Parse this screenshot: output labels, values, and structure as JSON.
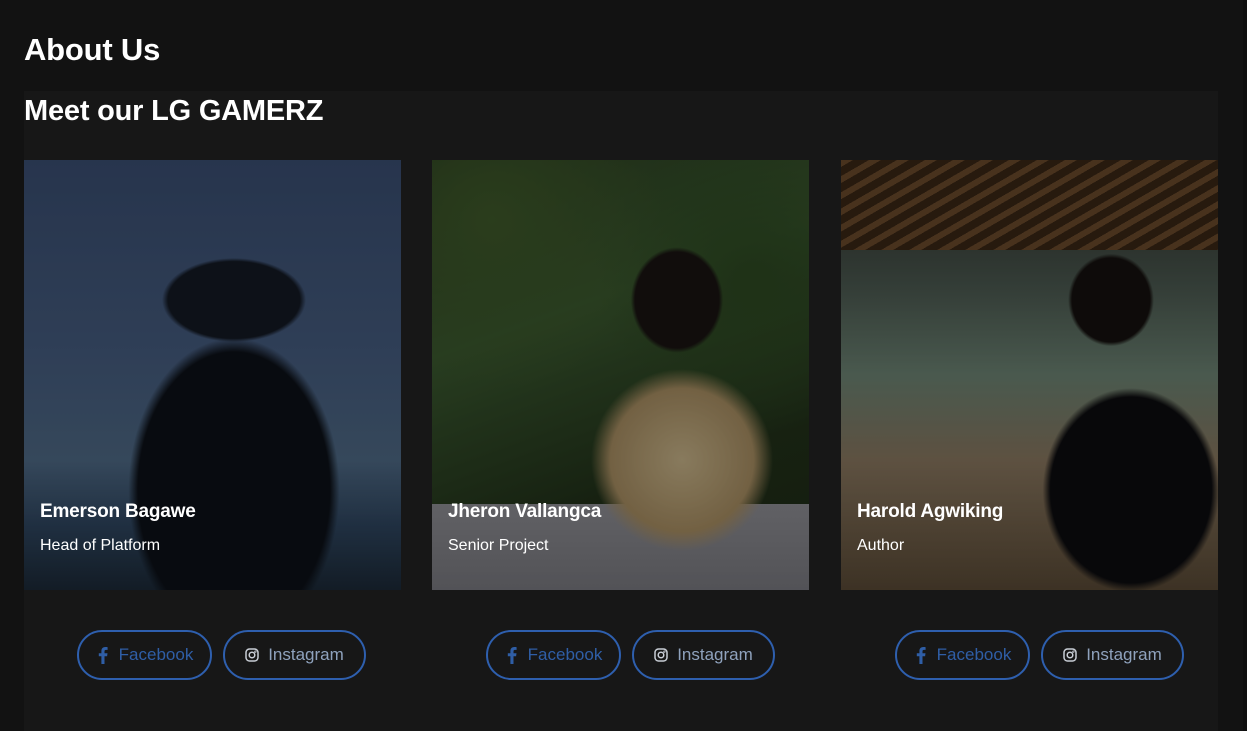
{
  "page": {
    "title": "About Us"
  },
  "section": {
    "title": "Meet our LG GAMERZ"
  },
  "team": [
    {
      "name": "Emerson Bagawe",
      "role": "Head of Platform",
      "facebook_label": "Facebook",
      "instagram_label": "Instagram"
    },
    {
      "name": "Jheron Vallangca",
      "role": "Senior Project",
      "facebook_label": "Facebook",
      "instagram_label": "Instagram"
    },
    {
      "name": "Harold Agwiking",
      "role": "Author",
      "facebook_label": "Facebook",
      "instagram_label": "Instagram"
    }
  ],
  "icons": {
    "facebook": "facebook-icon",
    "instagram": "instagram-icon"
  },
  "colors": {
    "background": "#121212",
    "section_background": "#171717",
    "button_border": "#2e5fae",
    "text": "#ffffff"
  }
}
